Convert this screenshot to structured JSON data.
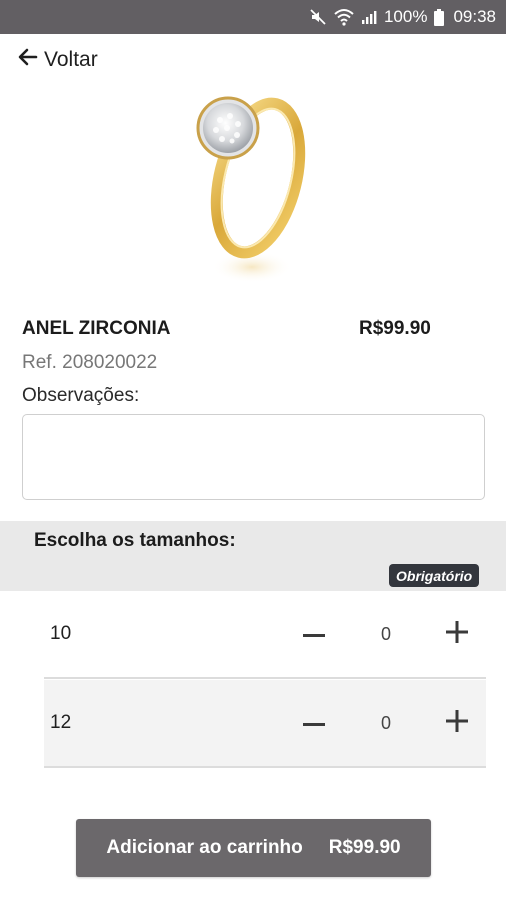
{
  "status_bar": {
    "battery": "100%",
    "time": "09:38",
    "icons": [
      "mute-icon",
      "wifi-icon",
      "signal-icon",
      "battery-icon"
    ]
  },
  "nav": {
    "back_label": "Voltar"
  },
  "product": {
    "name": "ANEL ZIRCONIA",
    "price": "R$99.90",
    "ref": "Ref. 208020022",
    "image": "gold-ring-with-zirconia"
  },
  "notes": {
    "label": "Observações:",
    "value": "",
    "placeholder": ""
  },
  "sizes": {
    "title": "Escolha os tamanhos:",
    "required_badge": "Obrigatório",
    "items": [
      {
        "label": "10",
        "quantity": "0"
      },
      {
        "label": "12",
        "quantity": "0"
      }
    ]
  },
  "cart": {
    "label": "Adicionar ao carrinho",
    "price": "R$99.90"
  },
  "colors": {
    "status_bar": "#625f63",
    "badge": "#33363d",
    "button": "#6b686b",
    "section_bg": "#e9e9e9"
  }
}
